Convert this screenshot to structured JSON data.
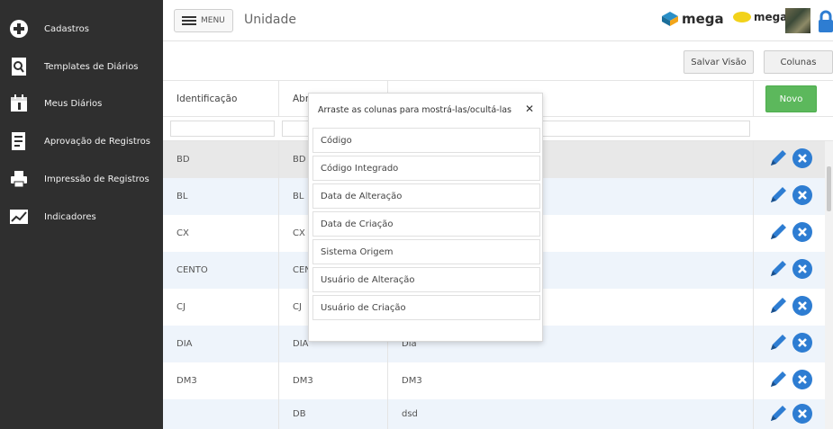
{
  "sidebar": {
    "items": [
      {
        "label": "Cadastros",
        "icon": "plus-circle-icon"
      },
      {
        "label": "Templates de Diários",
        "icon": "document-search-icon"
      },
      {
        "label": "Meus Diários",
        "icon": "calendar-icon"
      },
      {
        "label": "Aprovação de Registros",
        "icon": "checklist-icon"
      },
      {
        "label": "Impressão de Registros",
        "icon": "printer-icon"
      },
      {
        "label": "Indicadores",
        "icon": "line-chart-icon"
      }
    ]
  },
  "header": {
    "menu_label": "MENU",
    "title": "Unidade",
    "logo1": "mega",
    "logo2": "mega"
  },
  "toolbar": {
    "save_view_label": "Salvar Visão",
    "columns_label": "Colunas"
  },
  "grid": {
    "columns": [
      "Identificação",
      "Abre"
    ],
    "new_label": "Novo",
    "rows": [
      {
        "id": "BD",
        "abbr": "BD",
        "desc": ""
      },
      {
        "id": "BL",
        "abbr": "BL",
        "desc": ""
      },
      {
        "id": "CX",
        "abbr": "CX",
        "desc": ""
      },
      {
        "id": "CENTO",
        "abbr": "CEN",
        "desc": ""
      },
      {
        "id": "CJ",
        "abbr": "CJ",
        "desc": ""
      },
      {
        "id": "DIA",
        "abbr": "DIA",
        "desc": "Dia"
      },
      {
        "id": "DM3",
        "abbr": "DM3",
        "desc": "DM3"
      },
      {
        "id": "",
        "abbr": "DB",
        "desc": "dsd"
      }
    ]
  },
  "columns_popup": {
    "title": "Arraste as colunas para mostrá-las/ocultá-las",
    "close": "✕",
    "items": [
      "Código",
      "Código Integrado",
      "Data de Alteração",
      "Data de Criação",
      "Sistema Origem",
      "Usuário de Alteração",
      "Usuário de Criação"
    ]
  },
  "colors": {
    "sidebar_bg": "#2f2f2f",
    "accent_blue": "#2e7dd2",
    "new_green": "#5cb85c",
    "row_highlight": "#e8e8e8",
    "row_alt": "#eef4fb"
  }
}
